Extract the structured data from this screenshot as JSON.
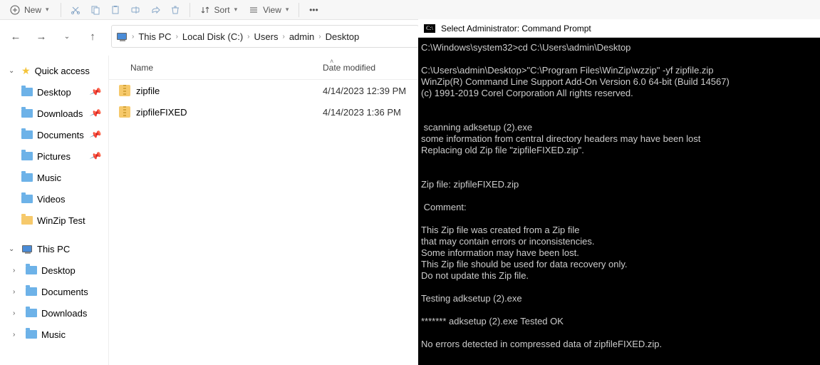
{
  "toolbar": {
    "new_label": "New",
    "sort_label": "Sort",
    "view_label": "View"
  },
  "breadcrumb": {
    "items": [
      "This PC",
      "Local Disk (C:)",
      "Users",
      "admin",
      "Desktop"
    ]
  },
  "sidebar": {
    "quick_access": "Quick access",
    "pinned": [
      {
        "label": "Desktop"
      },
      {
        "label": "Downloads"
      },
      {
        "label": "Documents"
      },
      {
        "label": "Pictures"
      },
      {
        "label": "Music"
      },
      {
        "label": "Videos"
      },
      {
        "label": "WinZip Test"
      }
    ],
    "this_pc": "This PC",
    "pc_items": [
      {
        "label": "Desktop"
      },
      {
        "label": "Documents"
      },
      {
        "label": "Downloads"
      },
      {
        "label": "Music"
      }
    ]
  },
  "columns": {
    "name": "Name",
    "date": "Date modified"
  },
  "files": [
    {
      "name": "zipfile",
      "date": "4/14/2023 12:39 PM"
    },
    {
      "name": "zipfileFIXED",
      "date": "4/14/2023 1:36 PM"
    }
  ],
  "cmd": {
    "title": "Select Administrator: Command Prompt",
    "body": "C:\\Windows\\system32>cd C:\\Users\\admin\\Desktop\n\nC:\\Users\\admin\\Desktop>\"C:\\Program Files\\WinZip\\wzzip\" -yf zipfile.zip\nWinZip(R) Command Line Support Add-On Version 6.0 64-bit (Build 14567)\n(c) 1991-2019 Corel Corporation All rights reserved.\n\n\n scanning adksetup (2).exe\nsome information from central directory headers may have been lost\nReplacing old Zip file \"zipfileFIXED.zip\".\n\n\nZip file: zipfileFIXED.zip\n\n Comment:\n\nThis Zip file was created from a Zip file\nthat may contain errors or inconsistencies.\nSome information may have been lost.\nThis Zip file should be used for data recovery only.\nDo not update this Zip file.\n\nTesting adksetup (2).exe\n\n******* adksetup (2).exe Tested OK\n\nNo errors detected in compressed data of zipfileFIXED.zip."
  }
}
